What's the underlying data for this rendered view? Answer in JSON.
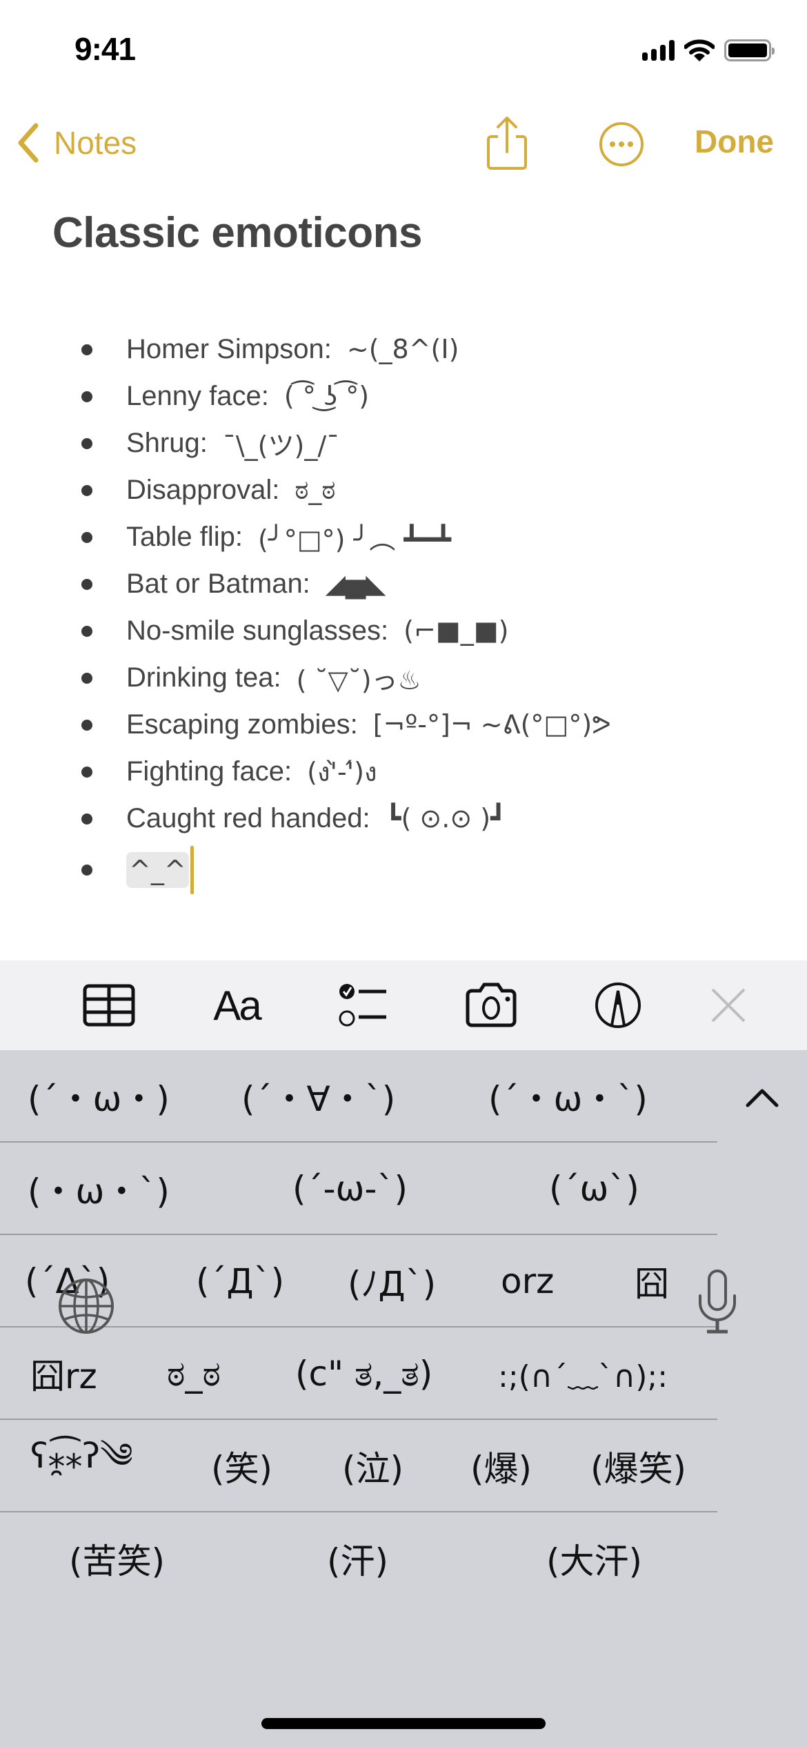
{
  "status_bar": {
    "time": "9:41",
    "icons": [
      "cellular-signal-icon",
      "wifi-icon",
      "battery-icon"
    ]
  },
  "nav": {
    "back_label": "Notes",
    "back_icon": "chevron-left-icon",
    "share_icon": "share-icon",
    "more_icon": "ellipsis-circle-icon",
    "done_label": "Done",
    "accent_color": "#d4ac3c"
  },
  "note": {
    "title": "Classic emoticons",
    "items": [
      {
        "label": "Homer Simpson:",
        "emoticon": "~(_8^(I)"
      },
      {
        "label": "Lenny face:",
        "emoticon": "( ͡° ͜ʖ ͡°)"
      },
      {
        "label": "Shrug:",
        "emoticon": "¯\\_(ツ)_/¯"
      },
      {
        "label": "Disapproval:",
        "emoticon": "ಠ_ಠ"
      },
      {
        "label": "Table flip:",
        "emoticon": "(╯°□°) ╯︵ ┻━┻"
      },
      {
        "label": "Bat or Batman:",
        "emoticon": "◢▅◣"
      },
      {
        "label": "No-smile sunglasses:",
        "emoticon": "(⌐■_■)"
      },
      {
        "label": "Drinking tea:",
        "emoticon": "( ˘▽˘)っ♨"
      },
      {
        "label": "Escaping zombies:",
        "emoticon": "[¬º-°]¬ ~ᕕ(°□°)ᕗ"
      },
      {
        "label": "Fighting face:",
        "emoticon": "(ง'̀-'́)ง"
      },
      {
        "label": "Caught red handed:",
        "emoticon": "┗( ⊙.⊙ )┛"
      }
    ],
    "current_input": "^_^"
  },
  "toolbar": {
    "items": [
      {
        "name": "table-icon",
        "label": ""
      },
      {
        "name": "format-text-button",
        "label": "Aa"
      },
      {
        "name": "checklist-icon",
        "label": ""
      },
      {
        "name": "camera-icon",
        "label": ""
      },
      {
        "name": "markup-pen-icon",
        "label": ""
      },
      {
        "name": "close-icon",
        "label": ""
      }
    ]
  },
  "keyboard": {
    "candidate_rows": [
      [
        "(´・ω・)",
        "(´・∀・`)",
        "(´・ω・`)"
      ],
      [
        "(・ω・`)",
        "(´-ω-`)",
        "(´ω`)"
      ],
      [
        "(´Δ`)",
        "(´Д`)",
        "(ﾉД`)",
        "orz",
        "囧"
      ],
      [
        "囧rz",
        "ಠ_ಠ",
        "(c\" ತ,_ತ)",
        ":;(∩´﹏`∩);:"
      ],
      [
        "ʕ⁎̯͡⁎ʔ༄",
        "(笑)",
        "(泣)",
        "(爆)",
        "(爆笑)"
      ],
      [
        "(苦笑)",
        "(汗)",
        "(大汗)"
      ]
    ],
    "expand_icon": "chevron-up-icon",
    "globe_icon": "globe-icon",
    "mic_icon": "microphone-icon"
  }
}
